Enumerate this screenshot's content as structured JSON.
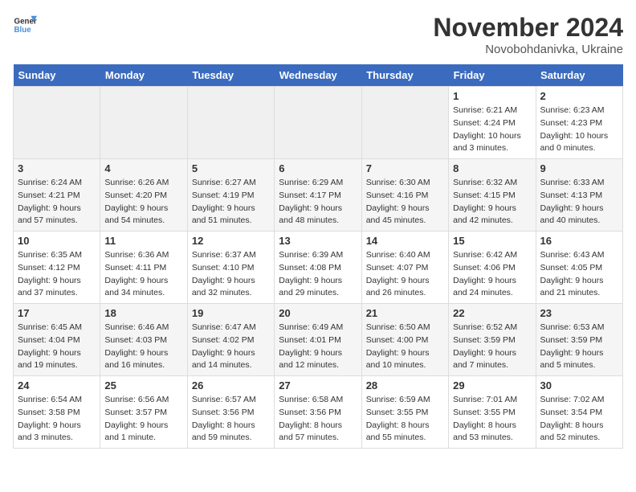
{
  "logo": {
    "general": "General",
    "blue": "Blue"
  },
  "title": "November 2024",
  "location": "Novobohdanivka, Ukraine",
  "headers": [
    "Sunday",
    "Monday",
    "Tuesday",
    "Wednesday",
    "Thursday",
    "Friday",
    "Saturday"
  ],
  "weeks": [
    [
      {
        "day": "",
        "empty": true
      },
      {
        "day": "",
        "empty": true
      },
      {
        "day": "",
        "empty": true
      },
      {
        "day": "",
        "empty": true
      },
      {
        "day": "",
        "empty": true
      },
      {
        "day": "1",
        "sunrise": "6:21 AM",
        "sunset": "4:24 PM",
        "daylight": "10 hours and 3 minutes."
      },
      {
        "day": "2",
        "sunrise": "6:23 AM",
        "sunset": "4:23 PM",
        "daylight": "10 hours and 0 minutes."
      }
    ],
    [
      {
        "day": "3",
        "sunrise": "6:24 AM",
        "sunset": "4:21 PM",
        "daylight": "9 hours and 57 minutes."
      },
      {
        "day": "4",
        "sunrise": "6:26 AM",
        "sunset": "4:20 PM",
        "daylight": "9 hours and 54 minutes."
      },
      {
        "day": "5",
        "sunrise": "6:27 AM",
        "sunset": "4:19 PM",
        "daylight": "9 hours and 51 minutes."
      },
      {
        "day": "6",
        "sunrise": "6:29 AM",
        "sunset": "4:17 PM",
        "daylight": "9 hours and 48 minutes."
      },
      {
        "day": "7",
        "sunrise": "6:30 AM",
        "sunset": "4:16 PM",
        "daylight": "9 hours and 45 minutes."
      },
      {
        "day": "8",
        "sunrise": "6:32 AM",
        "sunset": "4:15 PM",
        "daylight": "9 hours and 42 minutes."
      },
      {
        "day": "9",
        "sunrise": "6:33 AM",
        "sunset": "4:13 PM",
        "daylight": "9 hours and 40 minutes."
      }
    ],
    [
      {
        "day": "10",
        "sunrise": "6:35 AM",
        "sunset": "4:12 PM",
        "daylight": "9 hours and 37 minutes."
      },
      {
        "day": "11",
        "sunrise": "6:36 AM",
        "sunset": "4:11 PM",
        "daylight": "9 hours and 34 minutes."
      },
      {
        "day": "12",
        "sunrise": "6:37 AM",
        "sunset": "4:10 PM",
        "daylight": "9 hours and 32 minutes."
      },
      {
        "day": "13",
        "sunrise": "6:39 AM",
        "sunset": "4:08 PM",
        "daylight": "9 hours and 29 minutes."
      },
      {
        "day": "14",
        "sunrise": "6:40 AM",
        "sunset": "4:07 PM",
        "daylight": "9 hours and 26 minutes."
      },
      {
        "day": "15",
        "sunrise": "6:42 AM",
        "sunset": "4:06 PM",
        "daylight": "9 hours and 24 minutes."
      },
      {
        "day": "16",
        "sunrise": "6:43 AM",
        "sunset": "4:05 PM",
        "daylight": "9 hours and 21 minutes."
      }
    ],
    [
      {
        "day": "17",
        "sunrise": "6:45 AM",
        "sunset": "4:04 PM",
        "daylight": "9 hours and 19 minutes."
      },
      {
        "day": "18",
        "sunrise": "6:46 AM",
        "sunset": "4:03 PM",
        "daylight": "9 hours and 16 minutes."
      },
      {
        "day": "19",
        "sunrise": "6:47 AM",
        "sunset": "4:02 PM",
        "daylight": "9 hours and 14 minutes."
      },
      {
        "day": "20",
        "sunrise": "6:49 AM",
        "sunset": "4:01 PM",
        "daylight": "9 hours and 12 minutes."
      },
      {
        "day": "21",
        "sunrise": "6:50 AM",
        "sunset": "4:00 PM",
        "daylight": "9 hours and 10 minutes."
      },
      {
        "day": "22",
        "sunrise": "6:52 AM",
        "sunset": "3:59 PM",
        "daylight": "9 hours and 7 minutes."
      },
      {
        "day": "23",
        "sunrise": "6:53 AM",
        "sunset": "3:59 PM",
        "daylight": "9 hours and 5 minutes."
      }
    ],
    [
      {
        "day": "24",
        "sunrise": "6:54 AM",
        "sunset": "3:58 PM",
        "daylight": "9 hours and 3 minutes."
      },
      {
        "day": "25",
        "sunrise": "6:56 AM",
        "sunset": "3:57 PM",
        "daylight": "9 hours and 1 minute."
      },
      {
        "day": "26",
        "sunrise": "6:57 AM",
        "sunset": "3:56 PM",
        "daylight": "8 hours and 59 minutes."
      },
      {
        "day": "27",
        "sunrise": "6:58 AM",
        "sunset": "3:56 PM",
        "daylight": "8 hours and 57 minutes."
      },
      {
        "day": "28",
        "sunrise": "6:59 AM",
        "sunset": "3:55 PM",
        "daylight": "8 hours and 55 minutes."
      },
      {
        "day": "29",
        "sunrise": "7:01 AM",
        "sunset": "3:55 PM",
        "daylight": "8 hours and 53 minutes."
      },
      {
        "day": "30",
        "sunrise": "7:02 AM",
        "sunset": "3:54 PM",
        "daylight": "8 hours and 52 minutes."
      }
    ]
  ]
}
